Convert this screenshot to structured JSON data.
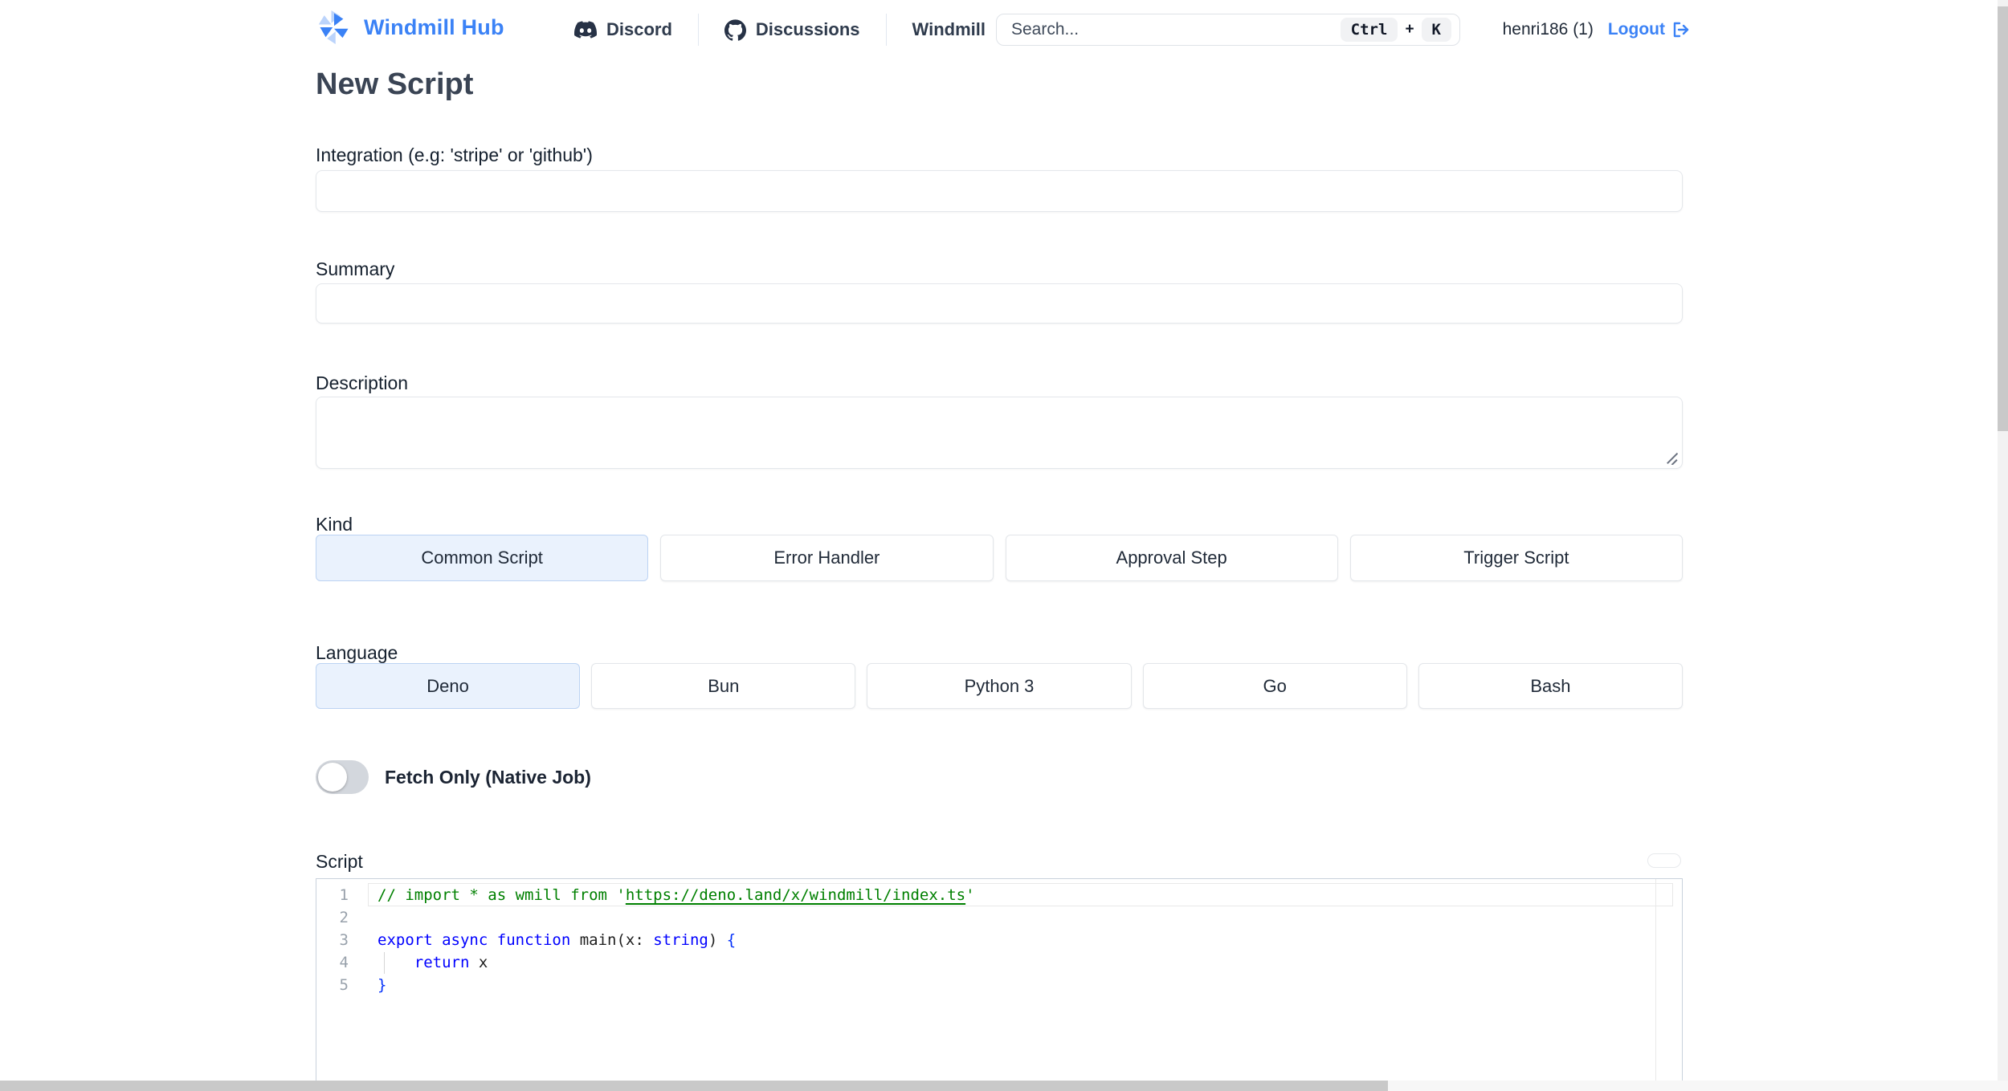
{
  "header": {
    "brand": "Windmill Hub",
    "nav": [
      {
        "id": "discord",
        "label": "Discord",
        "icon": "discord-icon"
      },
      {
        "id": "discussions",
        "label": "Discussions",
        "icon": "github-icon"
      },
      {
        "id": "windmill",
        "label": "Windmill",
        "icon": null
      }
    ],
    "search": {
      "placeholder": "Search...",
      "shortcut_keys": [
        "Ctrl",
        "K"
      ],
      "shortcut_separator": "+"
    },
    "username": "henri186 (1)",
    "logout_label": "Logout"
  },
  "page": {
    "title": "New Script",
    "integration_label": "Integration (e.g: 'stripe' or 'github')",
    "integration_value": "",
    "summary_label": "Summary",
    "summary_value": "",
    "description_label": "Description",
    "description_value": "",
    "kind_label": "Kind",
    "language_label": "Language",
    "fetch_only_label": "Fetch Only (Native Job)",
    "fetch_only_state": "off",
    "script_label": "Script"
  },
  "kind_options": [
    {
      "label": "Common Script",
      "selected": true
    },
    {
      "label": "Error Handler",
      "selected": false
    },
    {
      "label": "Approval Step",
      "selected": false
    },
    {
      "label": "Trigger Script",
      "selected": false
    }
  ],
  "language_options": [
    {
      "label": "Deno",
      "selected": true
    },
    {
      "label": "Bun",
      "selected": false
    },
    {
      "label": "Python 3",
      "selected": false
    },
    {
      "label": "Go",
      "selected": false
    },
    {
      "label": "Bash",
      "selected": false
    }
  ],
  "editor": {
    "lines": [
      {
        "num": "1",
        "active": true,
        "guide": false,
        "tokens": [
          {
            "t": "// import * as wmill from '",
            "c": "comment"
          },
          {
            "t": "https://deno.land/x/windmill/index.ts",
            "c": "comment-link"
          },
          {
            "t": "'",
            "c": "comment"
          }
        ]
      },
      {
        "num": "2",
        "active": false,
        "guide": false,
        "tokens": []
      },
      {
        "num": "3",
        "active": false,
        "guide": false,
        "tokens": [
          {
            "t": "export",
            "c": "kw"
          },
          {
            "t": " ",
            "c": "plain"
          },
          {
            "t": "async",
            "c": "kw"
          },
          {
            "t": " ",
            "c": "plain"
          },
          {
            "t": "function",
            "c": "kw"
          },
          {
            "t": " main(x: ",
            "c": "plain"
          },
          {
            "t": "string",
            "c": "kw"
          },
          {
            "t": ") ",
            "c": "plain"
          },
          {
            "t": "{",
            "c": "brace"
          }
        ]
      },
      {
        "num": "4",
        "active": false,
        "guide": true,
        "tokens": [
          {
            "t": "    ",
            "c": "plain"
          },
          {
            "t": "return",
            "c": "kw"
          },
          {
            "t": " x",
            "c": "plain"
          }
        ]
      },
      {
        "num": "5",
        "active": false,
        "guide": false,
        "tokens": [
          {
            "t": "}",
            "c": "brace"
          }
        ]
      }
    ]
  },
  "colors": {
    "accent": "#3b82f6",
    "selected_bg": "#eaf2fd",
    "selected_border": "#bcd3f3",
    "comment_green": "#008000",
    "keyword_blue": "#0000ff",
    "bracket_blue": "#0431fa",
    "scrollbar_thumb": "#c9c9c9"
  }
}
